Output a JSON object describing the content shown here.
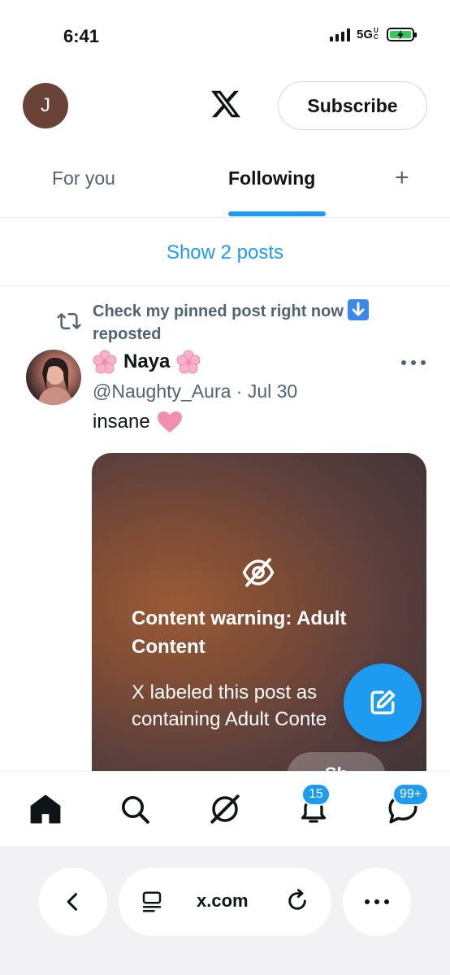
{
  "status_bar": {
    "time": "6:41",
    "network": "5G",
    "network_sub": "UC"
  },
  "header": {
    "avatar_initial": "J",
    "logo": "x-logo",
    "subscribe_label": "Subscribe"
  },
  "tabs": {
    "items": [
      {
        "label": "For you",
        "active": false
      },
      {
        "label": "Following",
        "active": true
      }
    ],
    "add_label": "+"
  },
  "feed": {
    "show_posts_label": "Show 2 posts",
    "post": {
      "repost_text": "Check my pinned post right now",
      "repost_suffix": "reposted",
      "author_name": "Naya",
      "author_emoji": "cherry-blossom",
      "handle": "@Naughty_Aura",
      "separator": "·",
      "date": "Jul 30",
      "text": "insane",
      "text_emoji": "pink-heart",
      "media_warning": {
        "title": "Content warning: Adult Content",
        "body_line1": "X labeled this post as",
        "body_line2": "containing Adult Conte",
        "show_label": "Sh"
      }
    }
  },
  "bottom_nav": {
    "items": [
      "home-icon",
      "search-icon",
      "grok-icon",
      "notifications-icon",
      "messages-icon"
    ],
    "notifications_badge": "15",
    "messages_badge": "99+"
  },
  "browser": {
    "url": "x.com"
  },
  "colors": {
    "accent": "#1d9bf0",
    "text": "#0f1419",
    "muted": "#536471"
  }
}
